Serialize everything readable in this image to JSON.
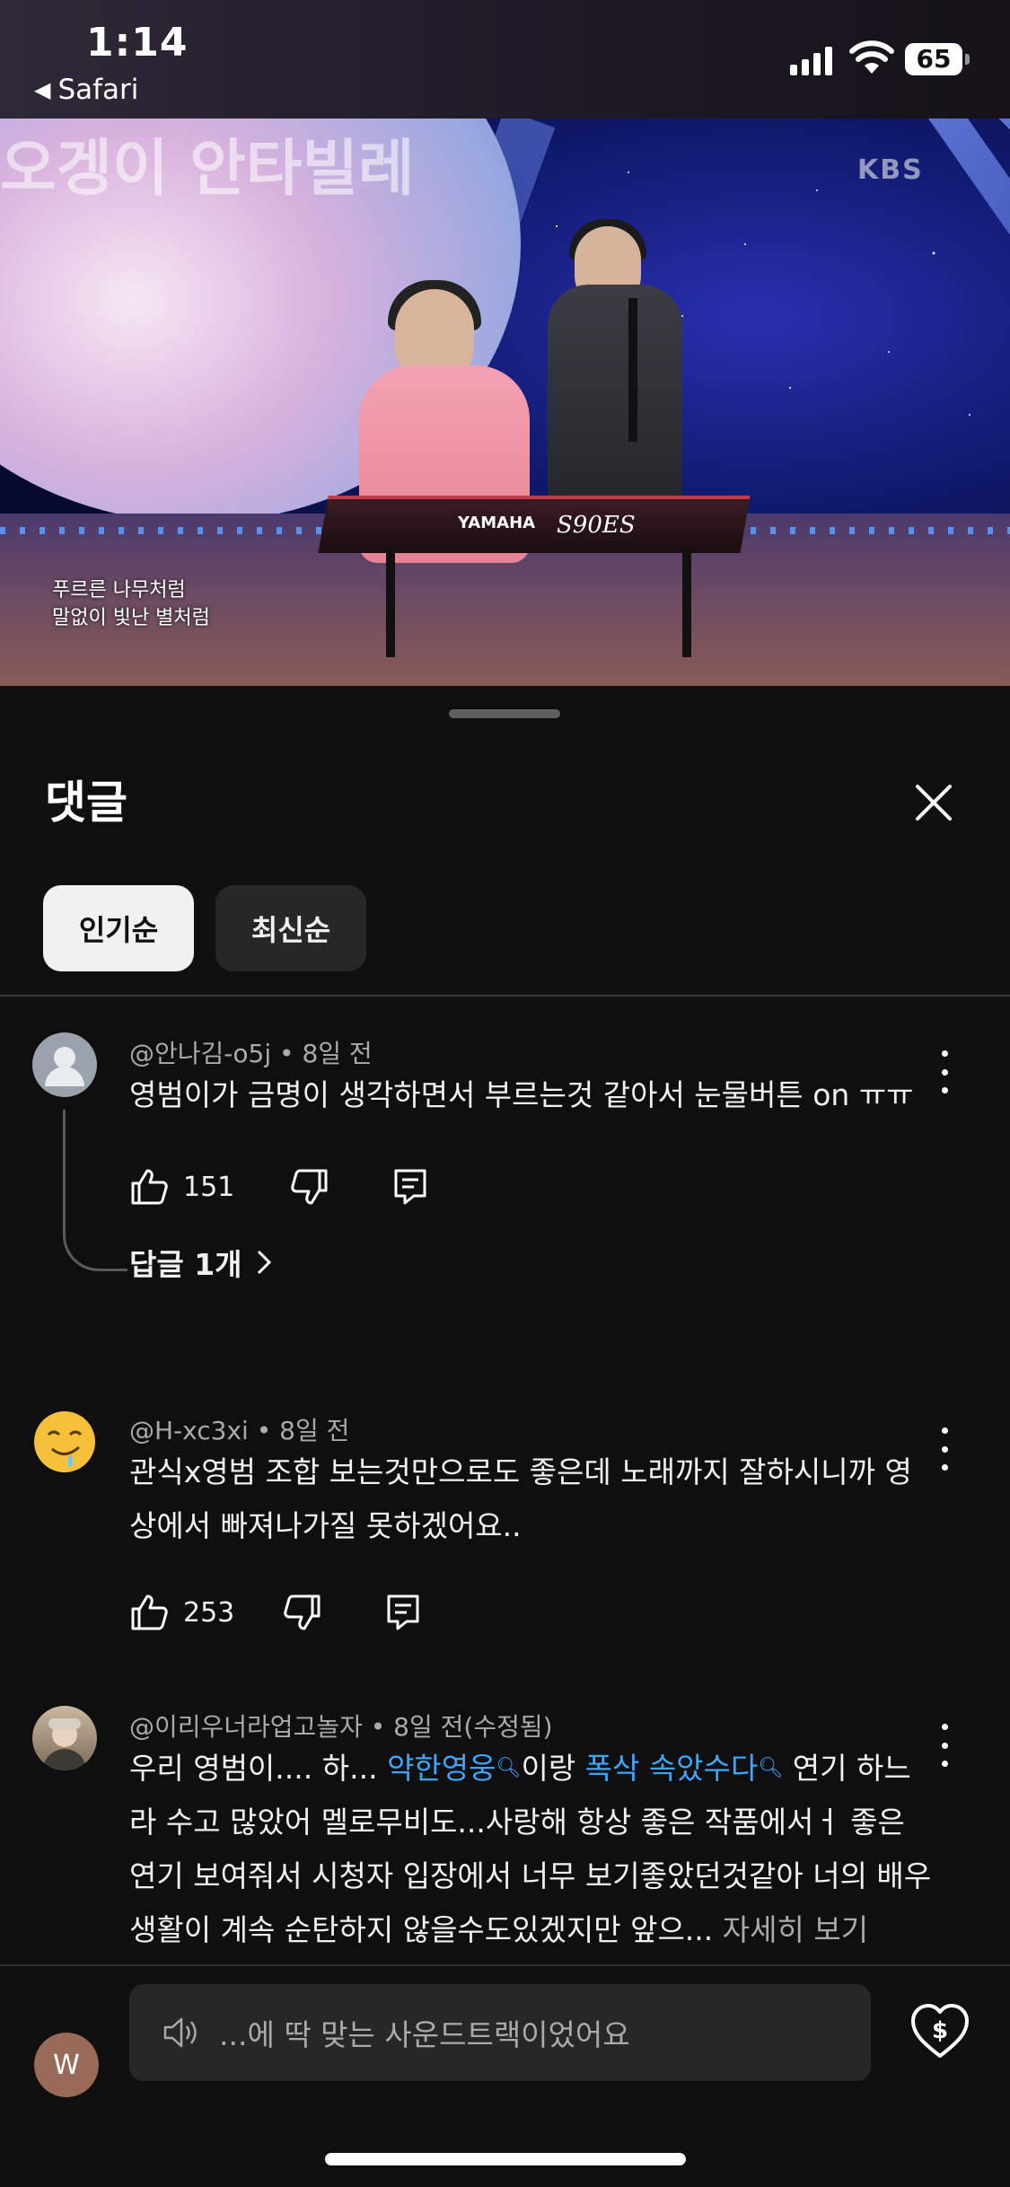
{
  "status_bar": {
    "time": "1:14",
    "back_app": "Safari",
    "battery": "65"
  },
  "video": {
    "show_title": "오겡이 안타빌레",
    "channel_logo": "KBS",
    "subtitle_line1": "푸르른 나무처럼",
    "subtitle_line2": "말없이 빛난 별처럼",
    "keyboard_brand": "YAMAHA",
    "keyboard_model": "S90ES",
    "progress_fraction": 0.285
  },
  "comments_panel": {
    "title": "댓글",
    "sort_chips": [
      {
        "label": "인기순",
        "selected": true
      },
      {
        "label": "최신순",
        "selected": false
      }
    ],
    "comments": [
      {
        "author": "@안나김-o5j",
        "time": "8일 전",
        "text": "영범이가 금명이 생각하면서 부르는것 같아서 눈물버튼 on ㅠㅠ",
        "likes": "151",
        "replies_label": "답글 1개"
      },
      {
        "author": "@H-xc3xi",
        "time": "8일 전",
        "text": "관식x영범 조합 보는것만으로도 좋은데 노래까지 잘하시니까 영상에서 빠져나가질 못하겠어요..",
        "likes": "253"
      },
      {
        "author": "@이리우너라업고놀자",
        "time": "8일 전(수정됨)",
        "text_start": "우리 영범이.... 하... ",
        "link1": "약한영웅",
        "text_mid": "이랑 ",
        "link2": "폭삭 속았수다",
        "text_end": " 연기 하느라 수고 많았어 멜로무비도...사랑해 항상 좋은 작품에서ㅓ 좋은 연기 보여줘서 시청자 입장에서 너무 보기좋았던것같아 너의 배우 생활이 계속 순탄하지 않을수도있겠지만 앞으... ",
        "see_more": "자세히 보기"
      }
    ]
  },
  "composer": {
    "user_initial": "W",
    "placeholder": "...에 딱 맞는 사운드트랙이었어요"
  },
  "colors": {
    "background": "#0f0f0f",
    "link": "#3ea6ff",
    "chip_selected": "#f1f1f1",
    "chip_unselected": "#272727",
    "muted_text": "#aaaaaa"
  },
  "icons": {
    "close": "close-icon",
    "like": "thumb-up-icon",
    "dislike": "thumb-down-icon",
    "reply": "reply-comment-icon",
    "more": "more-vertical-icon",
    "chevron": "chevron-right-icon",
    "search": "search-icon",
    "sound": "speaker-icon",
    "thanks": "super-thanks-icon"
  }
}
